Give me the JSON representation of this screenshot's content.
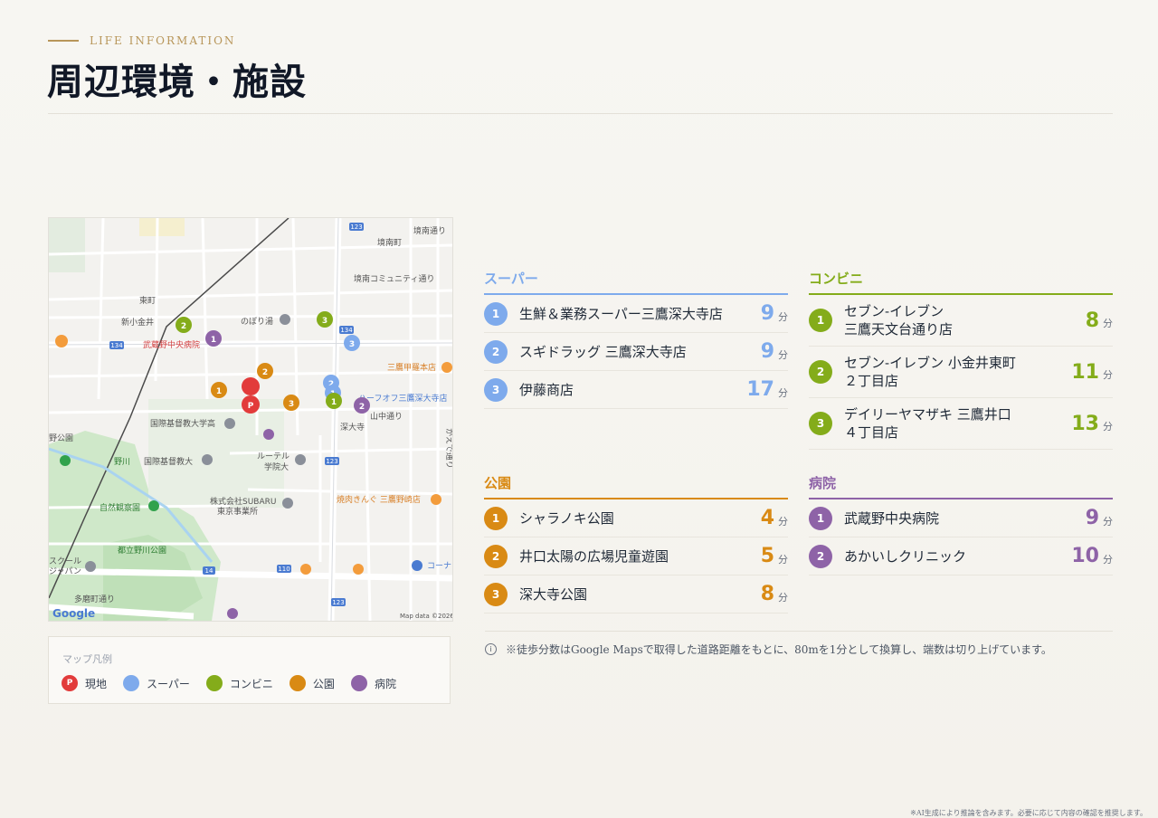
{
  "header": {
    "eyebrow": "LIFE INFORMATION",
    "title": "周辺環境・施設"
  },
  "map": {
    "labels": {
      "east_town": "東町",
      "shinkoganei": "新小金井",
      "noborigu": "のぼり湯",
      "hospital": "武蔵野中央病院",
      "sakaiminami": "境南町",
      "sakai_comm": "境南コミュニティ通り",
      "sakai_st": "境南通り",
      "icu_high": "国際基督教大学高",
      "icu": "国際基督教大",
      "lutheran1": "ルーテル",
      "lutheran2": "学院大",
      "subaru1": "株式会社SUBARU",
      "subaru2": "東京事業所",
      "shizen": "自然観察園",
      "nogawa_park": "都立野川公園",
      "nogawa": "野川",
      "park": "野公園",
      "jindaiji": "深大寺",
      "yamanaka": "山中通り",
      "tamamachi": "多磨町通り",
      "kaede": "かえで通り",
      "half": "ハーフオフ三鷹深大寺店",
      "mitaka_korea": "三鷹甲羅本店",
      "yakiniku": "焼肉きんぐ 三鷹野崎店",
      "corner": "コーナ",
      "school1": "スクール",
      "school2": "ジャパン",
      "r134a": "134",
      "r134b": "134",
      "r123a": "123",
      "r123b": "123",
      "r14": "14",
      "r110": "110",
      "google": "Google",
      "mapdata": "Map data ©2026",
      "park_word": "公園"
    },
    "pins": {
      "p": "P",
      "s1": "1",
      "s2": "2",
      "s3": "3",
      "c1": "1",
      "c2": "2",
      "c3": "3",
      "k1": "1",
      "k2": "2",
      "k3": "3",
      "h1": "1",
      "h2": "2"
    }
  },
  "legend": {
    "title": "マップ凡例",
    "items": [
      {
        "label": "現地",
        "color": "#e23b3b",
        "glyph": "P"
      },
      {
        "label": "スーパー",
        "color": "#7eaaec"
      },
      {
        "label": "コンビニ",
        "color": "#84ac1a"
      },
      {
        "label": "公園",
        "color": "#d98a14"
      },
      {
        "label": "病院",
        "color": "#8e63a7"
      }
    ]
  },
  "colors": {
    "super": "#7eaaec",
    "conv": "#84ac1a",
    "park": "#d98a14",
    "hospital": "#8e63a7",
    "site": "#e23b3b",
    "gold": "#b8965a"
  },
  "categories": {
    "super": {
      "title": "スーパー",
      "items": [
        {
          "no": "1",
          "name": "生鮮＆業務スーパー三鷹深大寺店",
          "min": "9",
          "unit": "分"
        },
        {
          "no": "2",
          "name": "スギドラッグ 三鷹深大寺店",
          "min": "9",
          "unit": "分"
        },
        {
          "no": "3",
          "name": "伊藤商店",
          "min": "17",
          "unit": "分"
        }
      ]
    },
    "conv": {
      "title": "コンビニ",
      "items": [
        {
          "no": "1",
          "name1": "セブン-イレブン",
          "name2": "三鷹天文台通り店",
          "min": "8",
          "unit": "分"
        },
        {
          "no": "2",
          "name1": "セブン-イレブン 小金井東町",
          "name2": "２丁目店",
          "min": "11",
          "unit": "分"
        },
        {
          "no": "3",
          "name1": "デイリーヤマザキ 三鷹井口",
          "name2": "４丁目店",
          "min": "13",
          "unit": "分"
        }
      ]
    },
    "park": {
      "title": "公園",
      "items": [
        {
          "no": "1",
          "name": "シャラノキ公園",
          "min": "4",
          "unit": "分"
        },
        {
          "no": "2",
          "name": "井口太陽の広場児童遊園",
          "min": "5",
          "unit": "分"
        },
        {
          "no": "3",
          "name": "深大寺公園",
          "min": "8",
          "unit": "分"
        }
      ]
    },
    "hospital": {
      "title": "病院",
      "items": [
        {
          "no": "1",
          "name": "武蔵野中央病院",
          "min": "9",
          "unit": "分"
        },
        {
          "no": "2",
          "name": "あかいしクリニック",
          "min": "10",
          "unit": "分"
        }
      ]
    }
  },
  "note": {
    "icon": "i",
    "text": "※徒歩分数はGoogle Mapsで取得した道路距離をもとに、80mを1分として換算し、端数は切り上げています。"
  },
  "footer": "※AI生成により推論を含みます。必要に応じて内容の確認を推奨します。"
}
